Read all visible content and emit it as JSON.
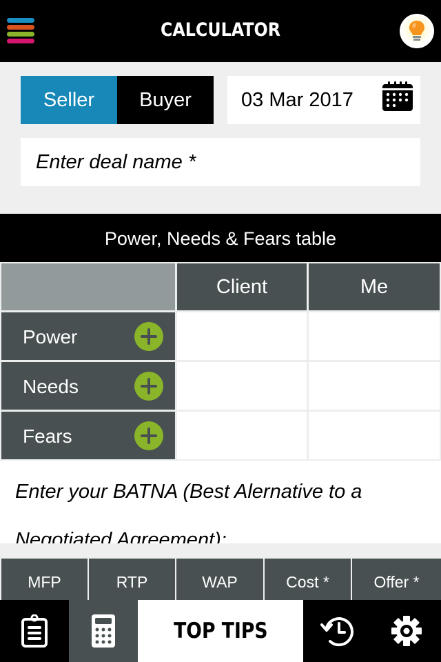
{
  "header": {
    "title": "CALCULATOR",
    "menu_icon": "hamburger-menu-icon",
    "menu_colors": [
      "#1a8fc4",
      "#d9531e",
      "#8ab52a",
      "#d4166e"
    ],
    "tip_icon": "lightbulb-icon"
  },
  "form": {
    "role_options": [
      {
        "label": "Seller",
        "selected": true
      },
      {
        "label": "Buyer",
        "selected": false
      }
    ],
    "date_value": "03 Mar 2017",
    "date_icon": "calendar-icon",
    "deal_name_placeholder": "Enter deal name *",
    "deal_name_value": ""
  },
  "pnf_table": {
    "title": "Power, Needs & Fears table",
    "columns": [
      "Client",
      "Me"
    ],
    "rows": [
      {
        "label": "Power",
        "client": "",
        "me": ""
      },
      {
        "label": "Needs",
        "client": "",
        "me": ""
      },
      {
        "label": "Fears",
        "client": "",
        "me": ""
      }
    ],
    "add_icon": "plus-circle-icon"
  },
  "batna": {
    "prompt": "Enter your BATNA (Best Alernative to a Negotiated Agreement):"
  },
  "price_buttons": [
    "MFP",
    "RTP",
    "WAP",
    "Cost *",
    "Offer *"
  ],
  "bottom_nav": {
    "items": [
      {
        "name": "notes",
        "icon": "clipboard-icon",
        "active": false
      },
      {
        "name": "calculator",
        "icon": "calculator-icon",
        "active": true
      },
      {
        "name": "top-tips",
        "label": "TOP TIPS"
      },
      {
        "name": "history",
        "icon": "history-icon",
        "active": false
      },
      {
        "name": "settings",
        "icon": "gear-icon",
        "active": false
      }
    ]
  },
  "colors": {
    "accent_blue": "#1788b8",
    "slate": "#485052",
    "slate_light": "#939a9b",
    "green": "#8ab52a",
    "background": "#efefef"
  }
}
